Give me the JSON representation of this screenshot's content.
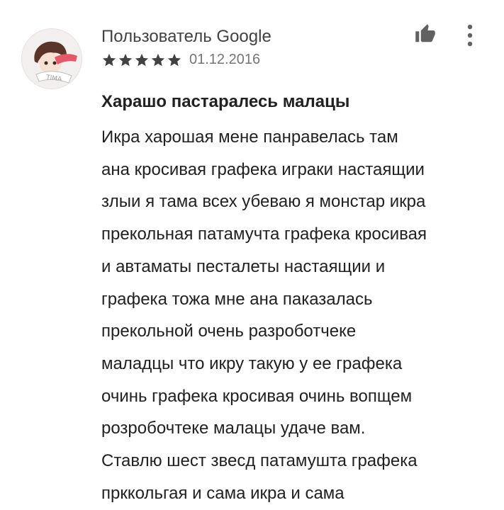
{
  "review": {
    "author": "Пользователь Google",
    "rating": 5,
    "rating_max": 5,
    "date": "01.12.2016",
    "avatar_text": "TIMA",
    "title": "Харашо пастаралесь малацы",
    "body_lines": [
      "Икра харошая мене панравелась там",
      "ана кросивая графека играки настаящии",
      "злыи я тама всех убеваю я монстар икра",
      "прекольная патамучта графека кросивая",
      "и автаматы песталеты настаящии и",
      "графека тожа мне ана паказалась",
      "прекольной очень разроботчеке",
      "маладцы что икру такую у ее графека",
      "очинь графека кросивая очинь вопщем",
      "розробочтеке малацы удаче вам.",
      "Ставлю шест звесд патамушта графека",
      "прккольгая и сама икра и сама"
    ]
  },
  "icons": {
    "like": "thumbs-up-icon",
    "more": "more-vert-icon",
    "star": "star-icon"
  },
  "colors": {
    "star": "#424242",
    "icon": "#616161",
    "text": "#212121",
    "secondary": "#757575"
  }
}
